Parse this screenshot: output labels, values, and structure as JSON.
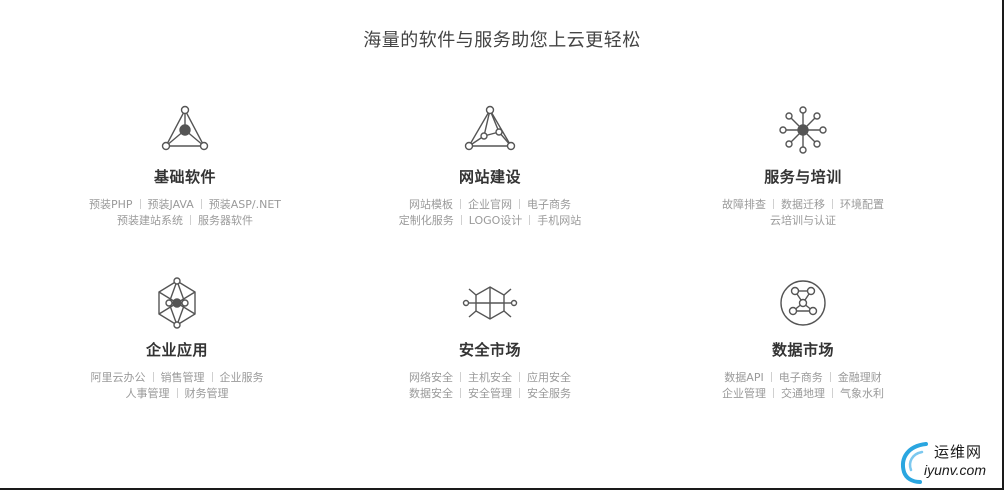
{
  "headline": "海量的软件与服务助您上云更轻松",
  "cards": [
    {
      "icon": "triangle-network-icon",
      "title": "基础软件",
      "rows": [
        [
          "预装PHP",
          "预装JAVA",
          "预装ASP/.NET"
        ],
        [
          "预装建站系统",
          "服务器软件"
        ]
      ]
    },
    {
      "icon": "pyramid-icon",
      "title": "网站建设",
      "rows": [
        [
          "网站模板",
          "企业官网",
          "电子商务"
        ],
        [
          "定制化服务",
          "LOGO设计",
          "手机网站"
        ]
      ]
    },
    {
      "icon": "hub-network-icon",
      "title": "服务与培训",
      "rows": [
        [
          "故障排查",
          "数据迁移",
          "环境配置"
        ],
        [
          "云培训与认证"
        ]
      ]
    },
    {
      "icon": "hexagon-network-icon",
      "title": "企业应用",
      "rows": [
        [
          "阿里云办公",
          "销售管理",
          "企业服务"
        ],
        [
          "人事管理",
          "财务管理"
        ]
      ]
    },
    {
      "icon": "cube-network-icon",
      "title": "安全市场",
      "rows": [
        [
          "网络安全",
          "主机安全",
          "应用安全"
        ],
        [
          "数据安全",
          "安全管理",
          "安全服务"
        ]
      ]
    },
    {
      "icon": "circle-network-icon",
      "title": "数据市场",
      "rows": [
        [
          "数据API",
          "电子商务",
          "金融理财"
        ],
        [
          "企业管理",
          "交通地理",
          "气象水利"
        ]
      ]
    }
  ],
  "watermark": {
    "line1": "运维网",
    "line2": "iyunv.com"
  }
}
